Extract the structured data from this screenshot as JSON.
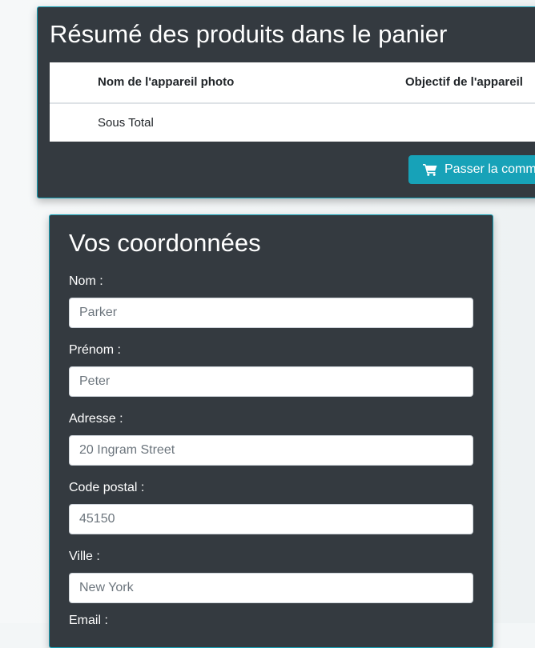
{
  "cart": {
    "title": "Résumé des produits dans le panier",
    "columns": [
      "Nom de l'appareil photo",
      "Objectif de l'appareil"
    ],
    "subtotal_label": "Sous Total",
    "order_button_label": "Passer la comm",
    "order_icon": "shopping-cart-icon"
  },
  "coords": {
    "title": "Vos coordonnées",
    "fields": [
      {
        "label": "Nom :",
        "placeholder": "Parker"
      },
      {
        "label": "Prénom :",
        "placeholder": "Peter"
      },
      {
        "label": "Adresse :",
        "placeholder": "20 Ingram Street"
      },
      {
        "label": "Code postal :",
        "placeholder": "45150"
      },
      {
        "label": "Ville :",
        "placeholder": "New York"
      },
      {
        "label": "Email :",
        "placeholder": ""
      }
    ]
  },
  "colors": {
    "card_background": "#343a40",
    "accent": "#17a2b8",
    "text_on_dark": "#ffffff"
  }
}
